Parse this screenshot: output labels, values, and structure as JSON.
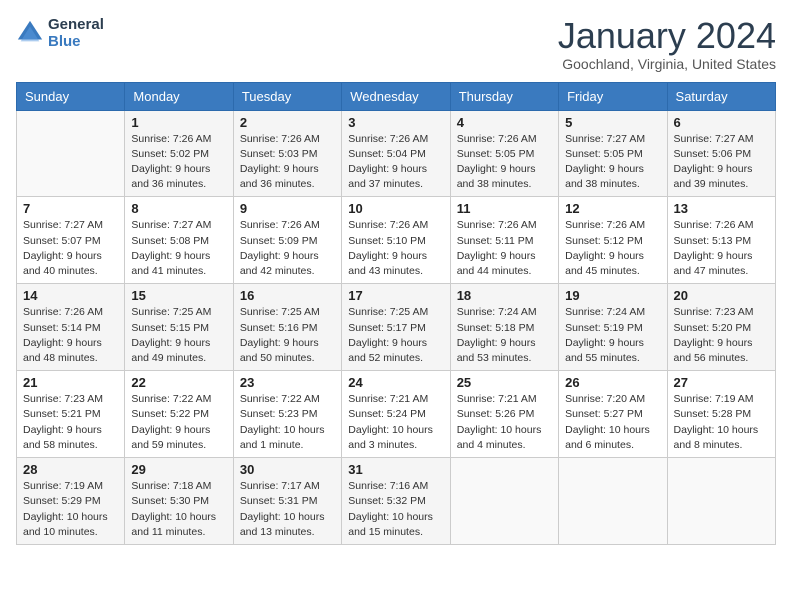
{
  "header": {
    "logo_line1": "General",
    "logo_line2": "Blue",
    "month_year": "January 2024",
    "location": "Goochland, Virginia, United States"
  },
  "days_of_week": [
    "Sunday",
    "Monday",
    "Tuesday",
    "Wednesday",
    "Thursday",
    "Friday",
    "Saturday"
  ],
  "weeks": [
    [
      {
        "day": "",
        "sunrise": "",
        "sunset": "",
        "daylight": ""
      },
      {
        "day": "1",
        "sunrise": "Sunrise: 7:26 AM",
        "sunset": "Sunset: 5:02 PM",
        "daylight": "Daylight: 9 hours and 36 minutes."
      },
      {
        "day": "2",
        "sunrise": "Sunrise: 7:26 AM",
        "sunset": "Sunset: 5:03 PM",
        "daylight": "Daylight: 9 hours and 36 minutes."
      },
      {
        "day": "3",
        "sunrise": "Sunrise: 7:26 AM",
        "sunset": "Sunset: 5:04 PM",
        "daylight": "Daylight: 9 hours and 37 minutes."
      },
      {
        "day": "4",
        "sunrise": "Sunrise: 7:26 AM",
        "sunset": "Sunset: 5:05 PM",
        "daylight": "Daylight: 9 hours and 38 minutes."
      },
      {
        "day": "5",
        "sunrise": "Sunrise: 7:27 AM",
        "sunset": "Sunset: 5:05 PM",
        "daylight": "Daylight: 9 hours and 38 minutes."
      },
      {
        "day": "6",
        "sunrise": "Sunrise: 7:27 AM",
        "sunset": "Sunset: 5:06 PM",
        "daylight": "Daylight: 9 hours and 39 minutes."
      }
    ],
    [
      {
        "day": "7",
        "sunrise": "Sunrise: 7:27 AM",
        "sunset": "Sunset: 5:07 PM",
        "daylight": "Daylight: 9 hours and 40 minutes."
      },
      {
        "day": "8",
        "sunrise": "Sunrise: 7:27 AM",
        "sunset": "Sunset: 5:08 PM",
        "daylight": "Daylight: 9 hours and 41 minutes."
      },
      {
        "day": "9",
        "sunrise": "Sunrise: 7:26 AM",
        "sunset": "Sunset: 5:09 PM",
        "daylight": "Daylight: 9 hours and 42 minutes."
      },
      {
        "day": "10",
        "sunrise": "Sunrise: 7:26 AM",
        "sunset": "Sunset: 5:10 PM",
        "daylight": "Daylight: 9 hours and 43 minutes."
      },
      {
        "day": "11",
        "sunrise": "Sunrise: 7:26 AM",
        "sunset": "Sunset: 5:11 PM",
        "daylight": "Daylight: 9 hours and 44 minutes."
      },
      {
        "day": "12",
        "sunrise": "Sunrise: 7:26 AM",
        "sunset": "Sunset: 5:12 PM",
        "daylight": "Daylight: 9 hours and 45 minutes."
      },
      {
        "day": "13",
        "sunrise": "Sunrise: 7:26 AM",
        "sunset": "Sunset: 5:13 PM",
        "daylight": "Daylight: 9 hours and 47 minutes."
      }
    ],
    [
      {
        "day": "14",
        "sunrise": "Sunrise: 7:26 AM",
        "sunset": "Sunset: 5:14 PM",
        "daylight": "Daylight: 9 hours and 48 minutes."
      },
      {
        "day": "15",
        "sunrise": "Sunrise: 7:25 AM",
        "sunset": "Sunset: 5:15 PM",
        "daylight": "Daylight: 9 hours and 49 minutes."
      },
      {
        "day": "16",
        "sunrise": "Sunrise: 7:25 AM",
        "sunset": "Sunset: 5:16 PM",
        "daylight": "Daylight: 9 hours and 50 minutes."
      },
      {
        "day": "17",
        "sunrise": "Sunrise: 7:25 AM",
        "sunset": "Sunset: 5:17 PM",
        "daylight": "Daylight: 9 hours and 52 minutes."
      },
      {
        "day": "18",
        "sunrise": "Sunrise: 7:24 AM",
        "sunset": "Sunset: 5:18 PM",
        "daylight": "Daylight: 9 hours and 53 minutes."
      },
      {
        "day": "19",
        "sunrise": "Sunrise: 7:24 AM",
        "sunset": "Sunset: 5:19 PM",
        "daylight": "Daylight: 9 hours and 55 minutes."
      },
      {
        "day": "20",
        "sunrise": "Sunrise: 7:23 AM",
        "sunset": "Sunset: 5:20 PM",
        "daylight": "Daylight: 9 hours and 56 minutes."
      }
    ],
    [
      {
        "day": "21",
        "sunrise": "Sunrise: 7:23 AM",
        "sunset": "Sunset: 5:21 PM",
        "daylight": "Daylight: 9 hours and 58 minutes."
      },
      {
        "day": "22",
        "sunrise": "Sunrise: 7:22 AM",
        "sunset": "Sunset: 5:22 PM",
        "daylight": "Daylight: 9 hours and 59 minutes."
      },
      {
        "day": "23",
        "sunrise": "Sunrise: 7:22 AM",
        "sunset": "Sunset: 5:23 PM",
        "daylight": "Daylight: 10 hours and 1 minute."
      },
      {
        "day": "24",
        "sunrise": "Sunrise: 7:21 AM",
        "sunset": "Sunset: 5:24 PM",
        "daylight": "Daylight: 10 hours and 3 minutes."
      },
      {
        "day": "25",
        "sunrise": "Sunrise: 7:21 AM",
        "sunset": "Sunset: 5:26 PM",
        "daylight": "Daylight: 10 hours and 4 minutes."
      },
      {
        "day": "26",
        "sunrise": "Sunrise: 7:20 AM",
        "sunset": "Sunset: 5:27 PM",
        "daylight": "Daylight: 10 hours and 6 minutes."
      },
      {
        "day": "27",
        "sunrise": "Sunrise: 7:19 AM",
        "sunset": "Sunset: 5:28 PM",
        "daylight": "Daylight: 10 hours and 8 minutes."
      }
    ],
    [
      {
        "day": "28",
        "sunrise": "Sunrise: 7:19 AM",
        "sunset": "Sunset: 5:29 PM",
        "daylight": "Daylight: 10 hours and 10 minutes."
      },
      {
        "day": "29",
        "sunrise": "Sunrise: 7:18 AM",
        "sunset": "Sunset: 5:30 PM",
        "daylight": "Daylight: 10 hours and 11 minutes."
      },
      {
        "day": "30",
        "sunrise": "Sunrise: 7:17 AM",
        "sunset": "Sunset: 5:31 PM",
        "daylight": "Daylight: 10 hours and 13 minutes."
      },
      {
        "day": "31",
        "sunrise": "Sunrise: 7:16 AM",
        "sunset": "Sunset: 5:32 PM",
        "daylight": "Daylight: 10 hours and 15 minutes."
      },
      {
        "day": "",
        "sunrise": "",
        "sunset": "",
        "daylight": ""
      },
      {
        "day": "",
        "sunrise": "",
        "sunset": "",
        "daylight": ""
      },
      {
        "day": "",
        "sunrise": "",
        "sunset": "",
        "daylight": ""
      }
    ]
  ]
}
